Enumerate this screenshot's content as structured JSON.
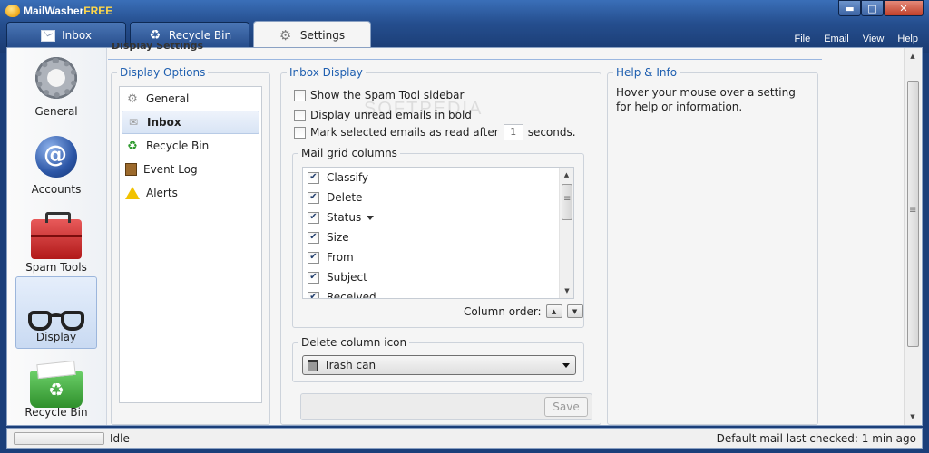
{
  "window": {
    "title": "MailWasher",
    "title_suffix": "FREE",
    "min": "▬",
    "max": "□",
    "close": "✕"
  },
  "tabs": [
    {
      "label": "Inbox",
      "icon": "mail-icon"
    },
    {
      "label": "Recycle Bin",
      "icon": "recycle-icon"
    },
    {
      "label": "Settings",
      "icon": "gear-icon",
      "active": true
    }
  ],
  "menu": [
    "File",
    "Email",
    "View",
    "Help"
  ],
  "leftnav": [
    {
      "label": "General",
      "icon": "gear-icon"
    },
    {
      "label": "Accounts",
      "icon": "accounts-icon"
    },
    {
      "label": "Spam Tools",
      "icon": "toolbox-icon"
    },
    {
      "label": "Display",
      "icon": "glasses-icon",
      "active": true
    },
    {
      "label": "Recycle Bin",
      "icon": "recycle-bin-icon"
    }
  ],
  "page": {
    "caption": "Display Settings",
    "watermark": "SOFTPEDIA"
  },
  "display_options": {
    "title": "Display Options",
    "items": [
      {
        "label": "General",
        "icon": "gear-icon"
      },
      {
        "label": "Inbox",
        "icon": "inbox-icon",
        "selected": true
      },
      {
        "label": "Recycle Bin",
        "icon": "recycle-icon"
      },
      {
        "label": "Event Log",
        "icon": "event-log-icon"
      },
      {
        "label": "Alerts",
        "icon": "warning-icon"
      }
    ]
  },
  "inbox_display": {
    "title": "Inbox Display",
    "show_sidebar": {
      "label": "Show the Spam Tool sidebar",
      "checked": false
    },
    "unread_bold": {
      "label": "Display unread emails in bold",
      "checked": false
    },
    "mark_read": {
      "label_before": "Mark selected emails as read after",
      "value": "1",
      "label_after": "seconds.",
      "checked": false
    },
    "mail_grid": {
      "title": "Mail grid columns",
      "columns": [
        {
          "label": "Classify",
          "checked": true
        },
        {
          "label": "Delete",
          "checked": true
        },
        {
          "label": "Status",
          "checked": true,
          "sorted": true
        },
        {
          "label": "Size",
          "checked": true
        },
        {
          "label": "From",
          "checked": true
        },
        {
          "label": "Subject",
          "checked": true
        },
        {
          "label": "Received",
          "checked": true
        }
      ],
      "order_label": "Column order:",
      "up": "▲",
      "down": "▼"
    },
    "delete_icon": {
      "title": "Delete column icon",
      "selected": "Trash can"
    },
    "save_label": "Save"
  },
  "help": {
    "title": "Help & Info",
    "text": "Hover your mouse over a setting for help or information."
  },
  "status": {
    "text": "Idle",
    "last_checked": "Default mail last checked: 1 min ago"
  }
}
